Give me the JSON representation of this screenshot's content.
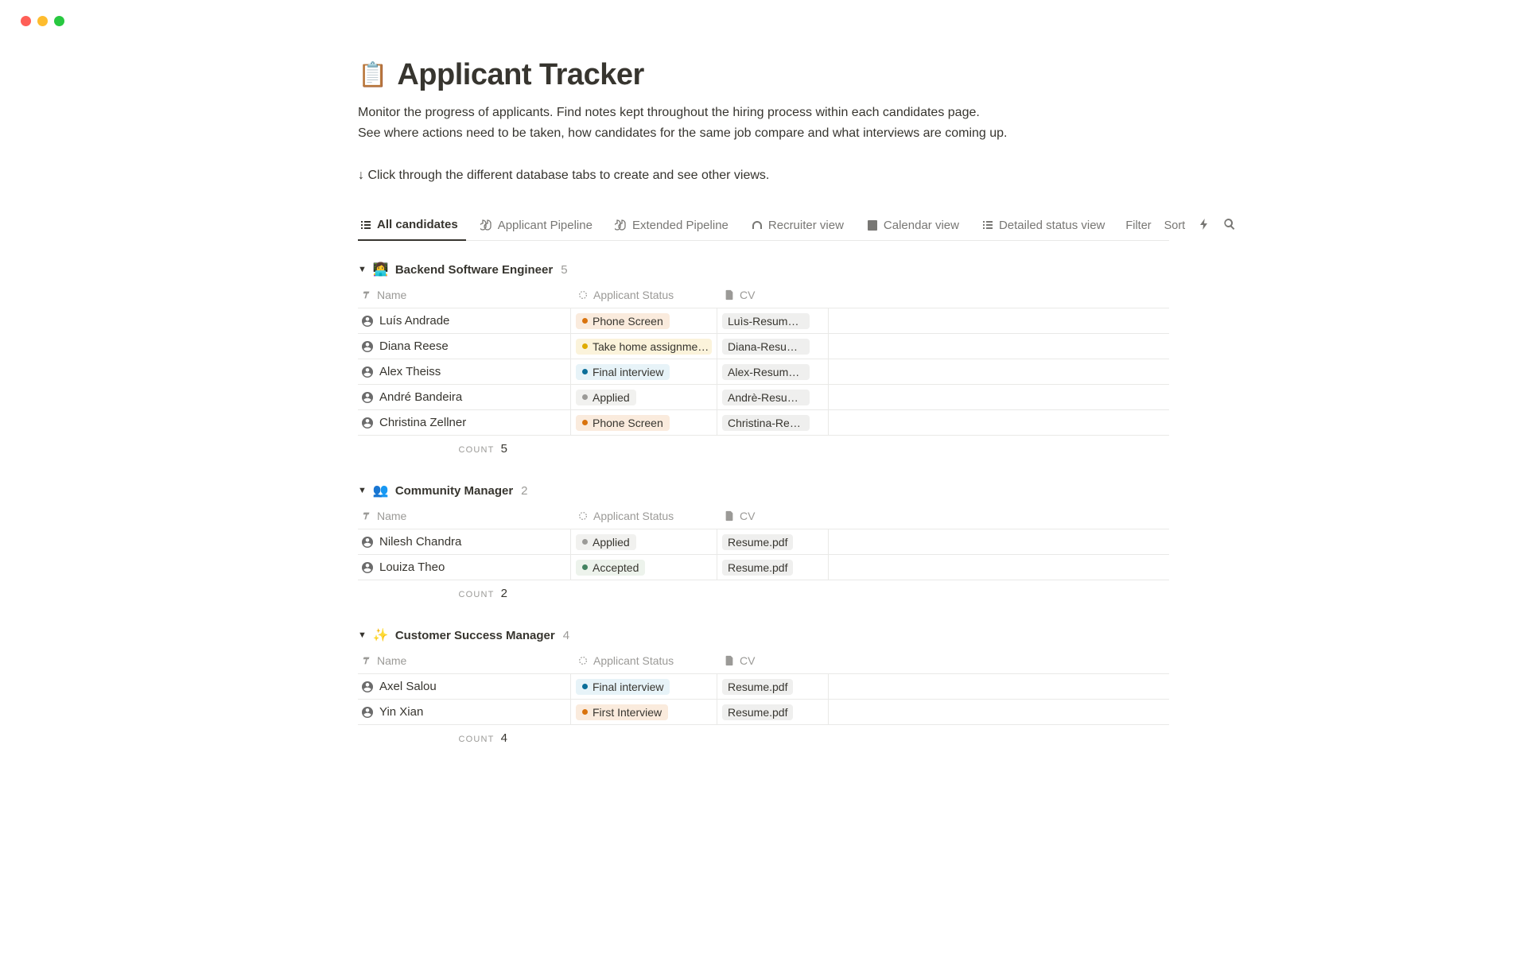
{
  "title": "Applicant Tracker",
  "description_line1": "Monitor the progress of applicants. Find notes kept throughout the hiring process within each candidates page.",
  "description_line2": "See where actions need to be taken, how candidates for the same job compare and what interviews are coming up.",
  "hint": "↓ Click through the different database tabs to create and see other views.",
  "tabs": [
    {
      "label": "All candidates"
    },
    {
      "label": "Applicant Pipeline"
    },
    {
      "label": "Extended Pipeline"
    },
    {
      "label": "Recruiter view"
    },
    {
      "label": "Calendar view"
    },
    {
      "label": "Detailed status view"
    }
  ],
  "actions": {
    "filter": "Filter",
    "sort": "Sort"
  },
  "column_headers": {
    "name": "Name",
    "status": "Applicant Status",
    "cv": "CV"
  },
  "count_label": "COUNT",
  "status_styles": {
    "Phone Screen": "pill-orange",
    "Take home assignme…": "pill-yellow",
    "Final interview": "pill-blue",
    "Applied": "pill-gray",
    "Accepted": "pill-green",
    "First Interview": "pill-orange"
  },
  "groups": [
    {
      "emoji": "👩‍💻",
      "name": "Backend Software Engineer",
      "count": "5",
      "rows": [
        {
          "name": "Luís Andrade",
          "status": "Phone Screen",
          "cv": "Luìs-Resume.p…"
        },
        {
          "name": "Diana Reese",
          "status": "Take home assignme…",
          "cv": "Diana-Resume…"
        },
        {
          "name": "Alex Theiss",
          "status": "Final interview",
          "cv": "Alex-Resume.…"
        },
        {
          "name": "André Bandeira",
          "status": "Applied",
          "cv": "Andrè-Resume…"
        },
        {
          "name": "Christina Zellner",
          "status": "Phone Screen",
          "cv": "Christina-Resu…"
        }
      ],
      "footer_count": "5"
    },
    {
      "emoji": "👥",
      "name": "Community Manager",
      "count": "2",
      "rows": [
        {
          "name": "Nilesh Chandra",
          "status": "Applied",
          "cv": "Resume.pdf"
        },
        {
          "name": "Louiza Theo",
          "status": "Accepted",
          "cv": "Resume.pdf"
        }
      ],
      "footer_count": "2"
    },
    {
      "emoji": "✨",
      "name": "Customer Success Manager",
      "count": "4",
      "rows": [
        {
          "name": "Axel Salou",
          "status": "Final interview",
          "cv": "Resume.pdf"
        },
        {
          "name": "Yin Xian",
          "status": "First Interview",
          "cv": "Resume.pdf"
        }
      ],
      "footer_count": "4"
    }
  ]
}
